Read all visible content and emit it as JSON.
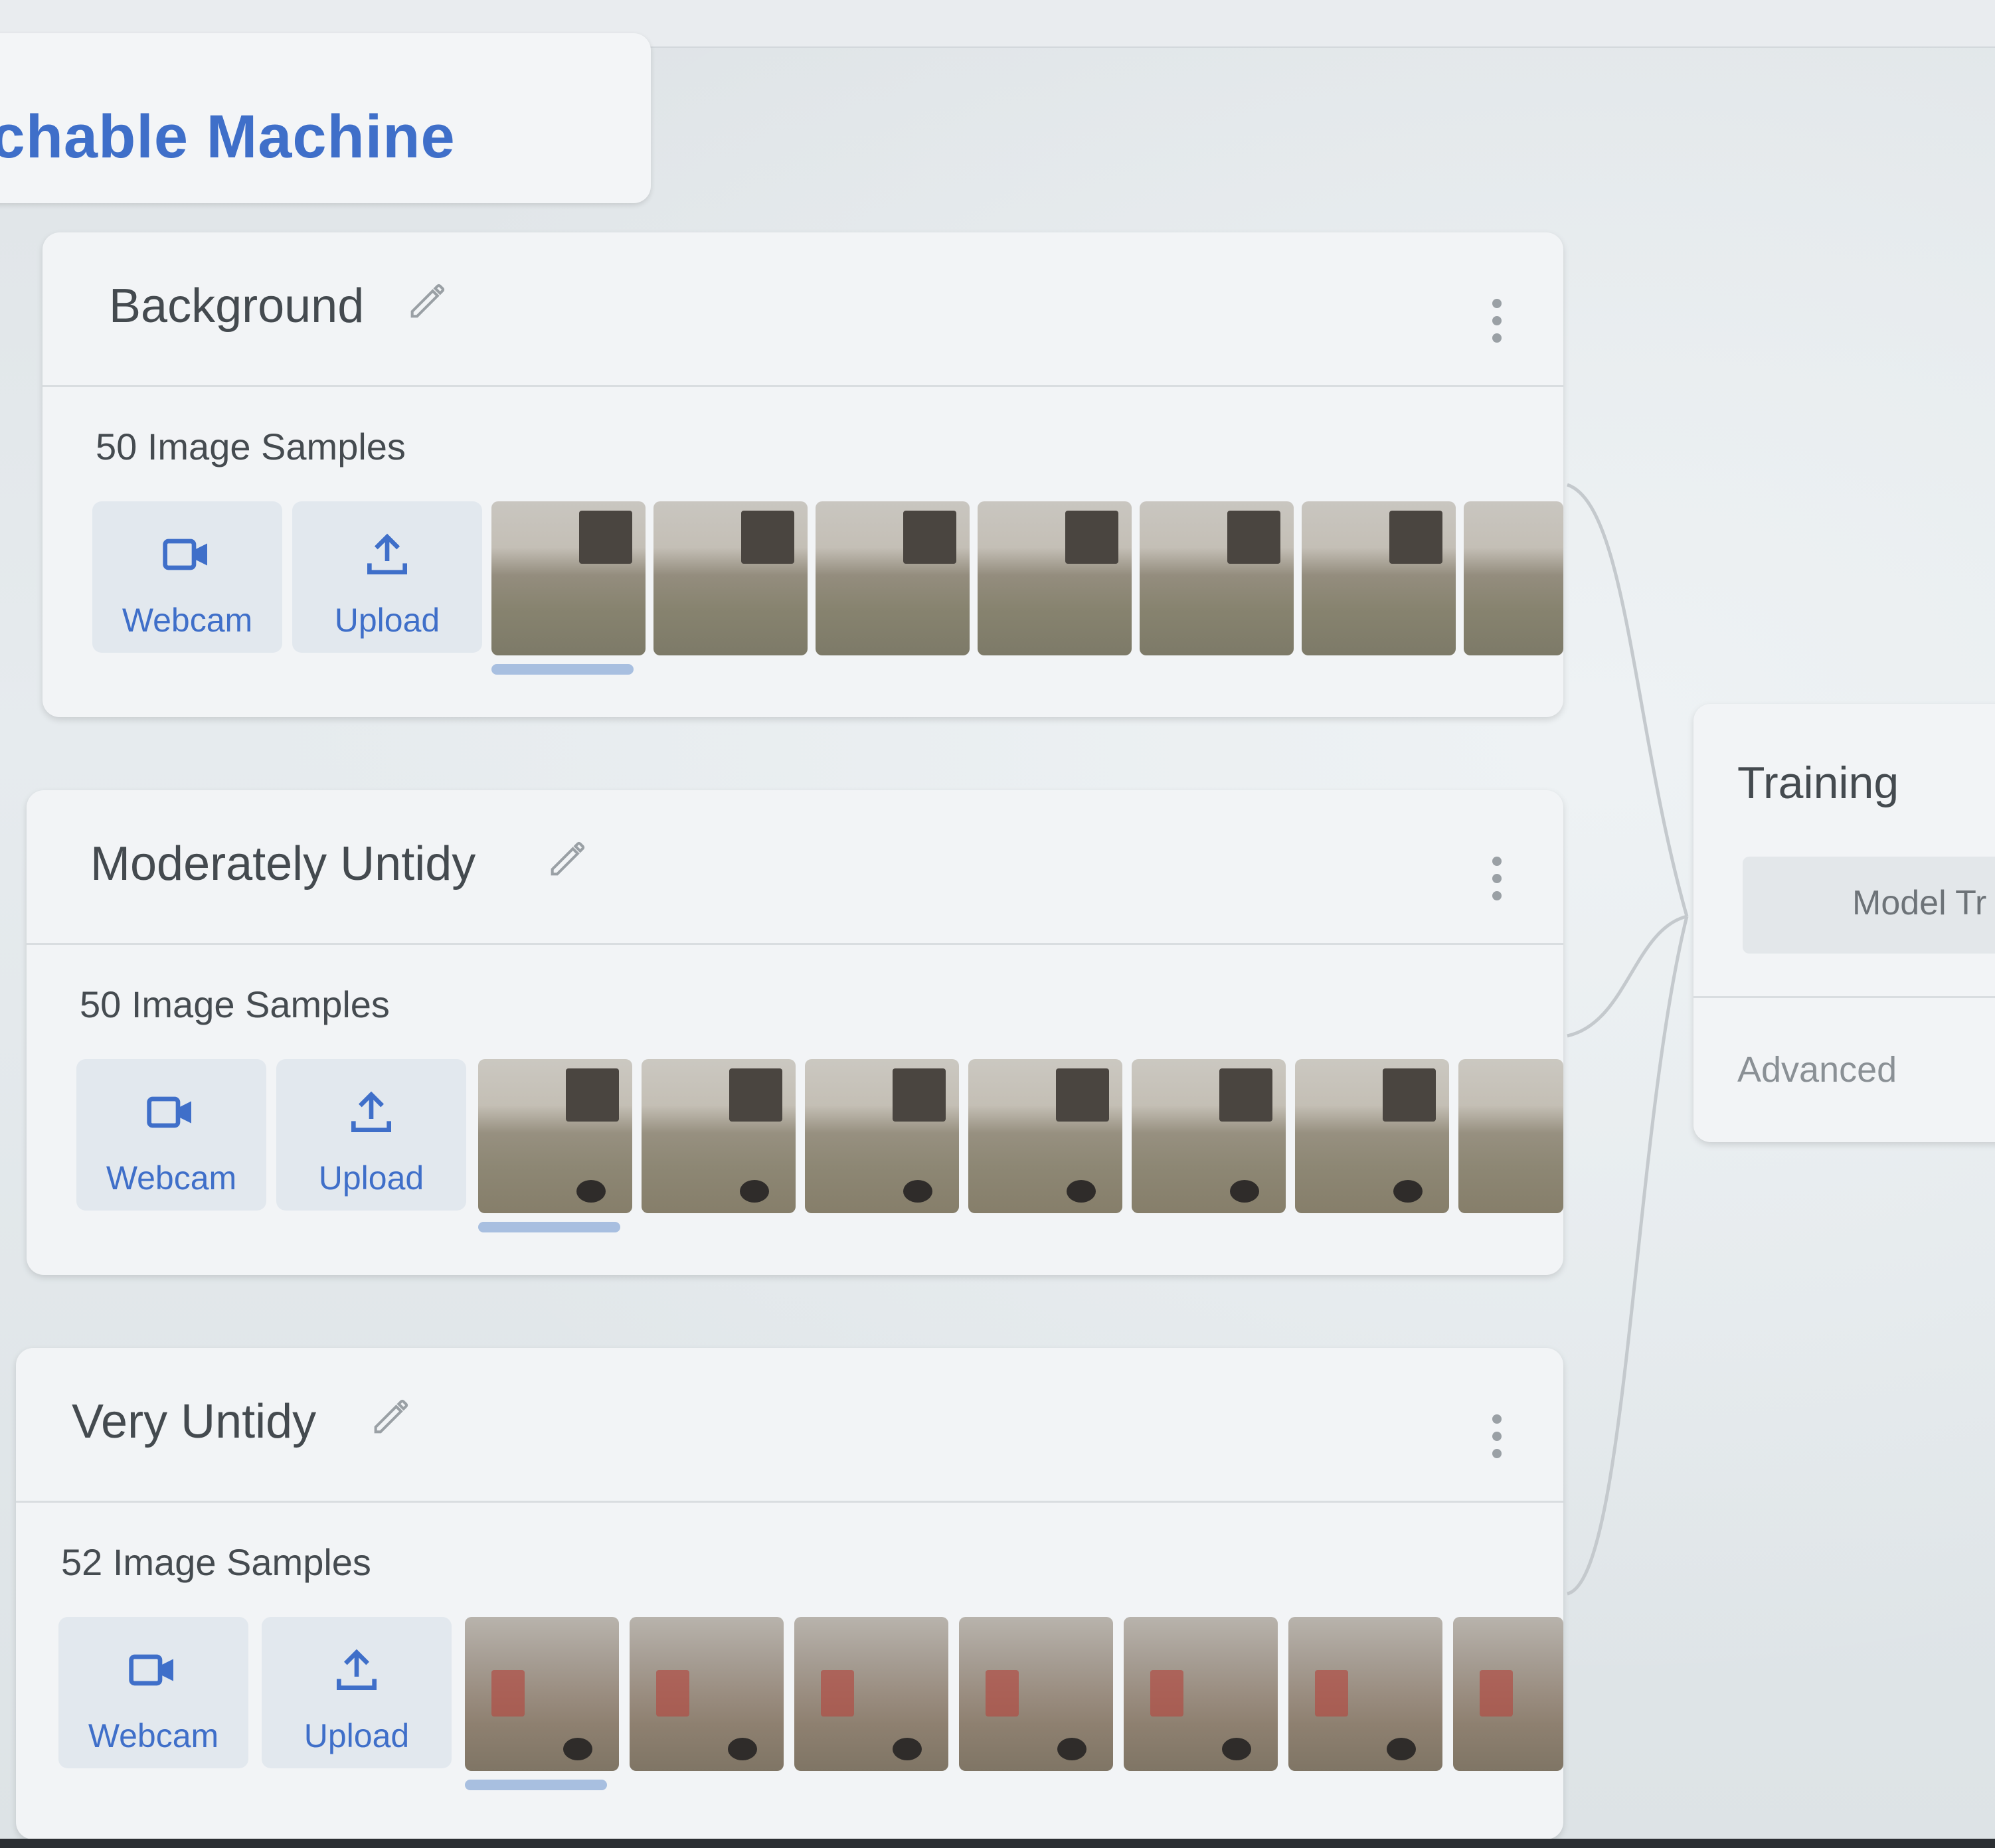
{
  "brand": {
    "title": "ıchable Machine"
  },
  "classes": [
    {
      "name": "Background",
      "count_label": "50 Image Samples",
      "webcam_label": "Webcam",
      "upload_label": "Upload"
    },
    {
      "name": "Moderately Untidy",
      "count_label": "50 Image Samples",
      "webcam_label": "Webcam",
      "upload_label": "Upload"
    },
    {
      "name": "Very Untidy",
      "count_label": "52 Image Samples",
      "webcam_label": "Webcam",
      "upload_label": "Upload"
    }
  ],
  "training": {
    "title": "Training",
    "train_button": "Model Tr",
    "advanced_label": "Advanced"
  },
  "icons": {
    "edit": "pencil-icon",
    "menu": "more-vert-icon",
    "webcam": "videocam-icon",
    "upload": "upload-icon"
  },
  "colors": {
    "accent": "#3f6fc9",
    "button_bg": "#e2e8ee",
    "progress": "#a8bfe0"
  }
}
